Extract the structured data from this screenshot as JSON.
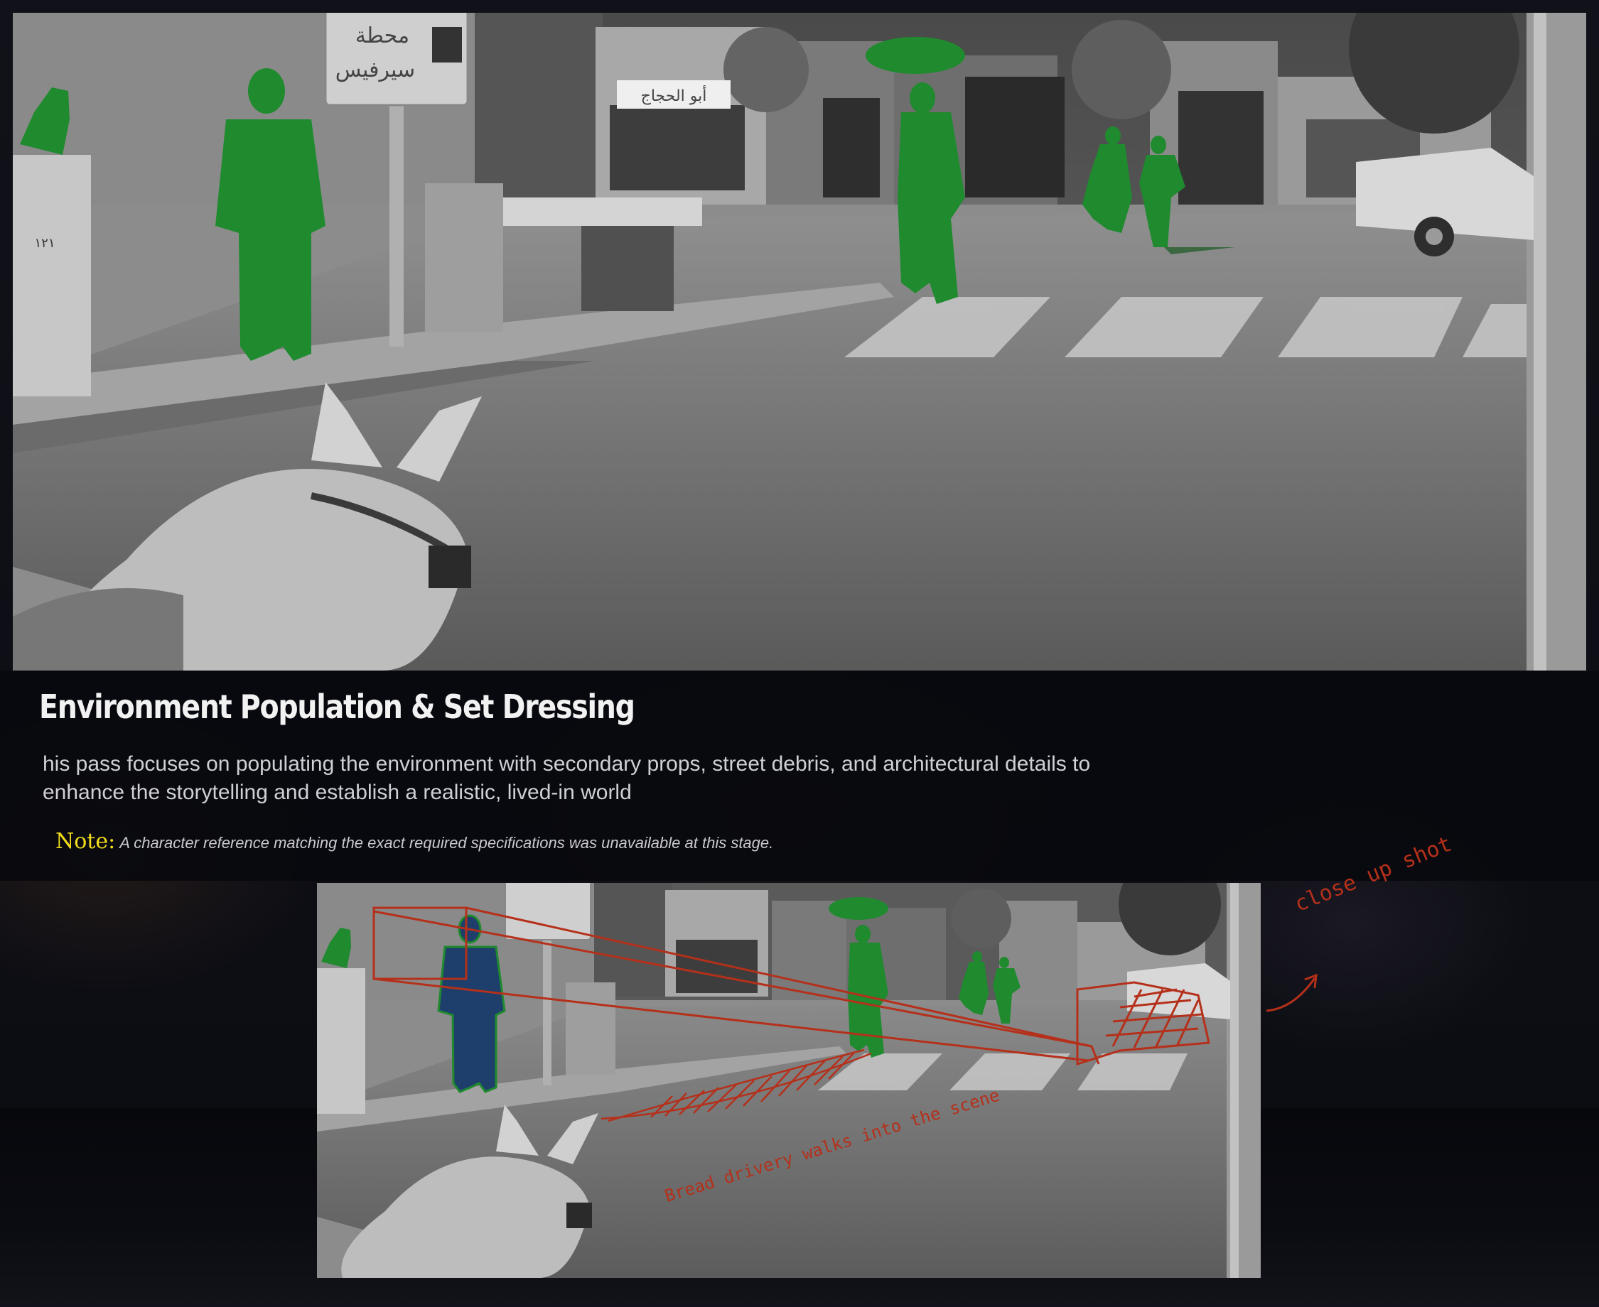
{
  "section": {
    "title": "Environment Population & Set Dressing",
    "body": "his pass focuses on populating the environment with secondary props, street debris, and architectural details to enhance the storytelling and establish a realistic, lived-in world",
    "note_label": "Note:",
    "note_text": "A character reference matching the exact required specifications was unavailable at this stage."
  },
  "main_scene": {
    "bus_sign_line1": "محطة",
    "bus_sign_line2": "سيرفيس",
    "shop_sign": "أبو الحجاج",
    "utility_box_number": "١٢١"
  },
  "annotations": {
    "close_up": "close up shot",
    "bread_delivery": "Bread drivery walks into the scene"
  },
  "colors": {
    "page_background": "#0a0b10",
    "note_label": "#f2de1c",
    "figure_mask_green": "#1f8a2e",
    "figure_mask_blue": "#1e3f6b",
    "annotation_red": "#b5301a"
  }
}
